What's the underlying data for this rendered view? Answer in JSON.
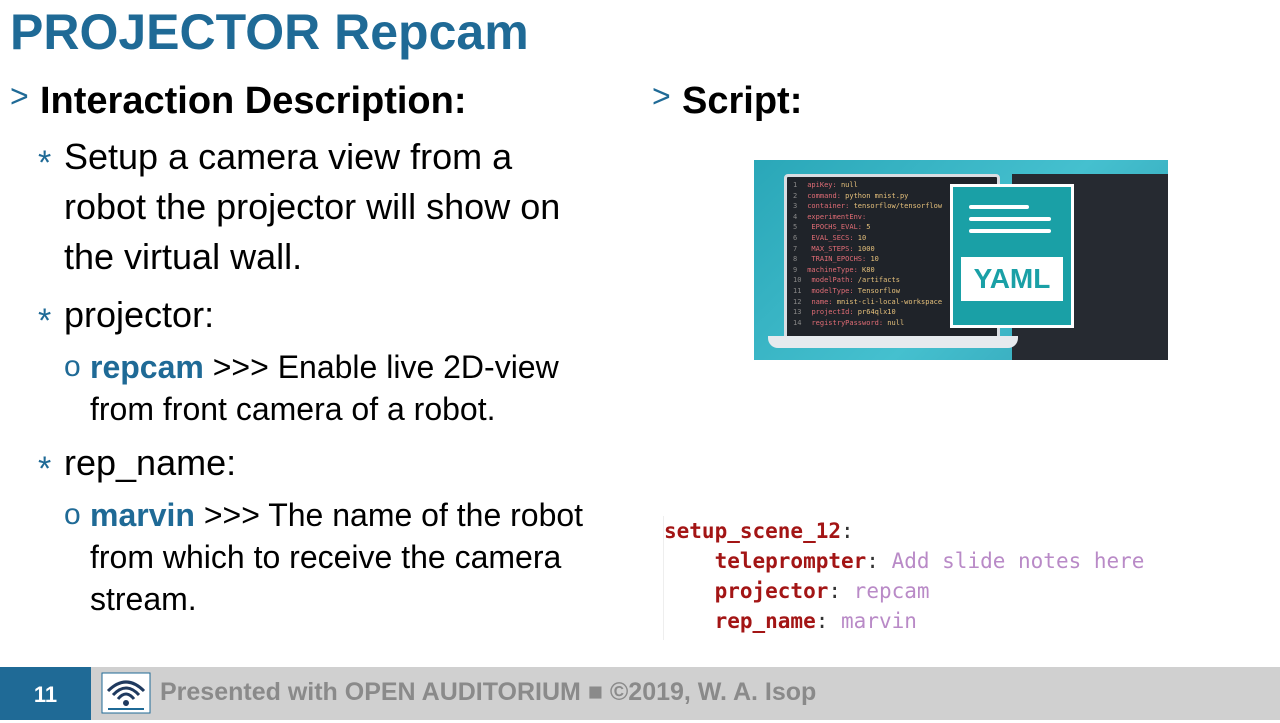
{
  "slide": {
    "title": "PROJECTOR Repcam"
  },
  "left": {
    "heading_marker": ">",
    "heading": "Interaction Description:",
    "bullets": [
      {
        "marker": "*",
        "text": "Setup a camera view from a robot the projector will show on the virtual wall."
      },
      {
        "marker": "*",
        "text": "projector:",
        "sub": {
          "marker": "o",
          "keyword": "repcam",
          "text": " >>> Enable live 2D-view from front camera of a robot."
        }
      },
      {
        "marker": "*",
        "text": "rep_name:",
        "sub": {
          "marker": "o",
          "keyword": "marvin",
          "text": " >>> The name of the robot from which to receive the camera stream."
        }
      }
    ]
  },
  "right": {
    "heading_marker": ">",
    "heading": "Script:",
    "image": {
      "badge": "YAML",
      "code_lines": [
        {
          "n": "1",
          "k": "apiKey:",
          "v": "null"
        },
        {
          "n": "2",
          "k": "command:",
          "v": "python mnist.py"
        },
        {
          "n": "3",
          "k": "container:",
          "v": "tensorflow/tensorflow"
        },
        {
          "n": "4",
          "k": "experimentEnv:",
          "v": ""
        },
        {
          "n": "5",
          "k": "  EPOCHS_EVAL:",
          "v": "5"
        },
        {
          "n": "6",
          "k": "  EVAL_SECS:",
          "v": "10"
        },
        {
          "n": "7",
          "k": "  MAX_STEPS:",
          "v": "1000"
        },
        {
          "n": "8",
          "k": "  TRAIN_EPOCHS:",
          "v": "10"
        },
        {
          "n": "9",
          "k": "machineType:",
          "v": "K80"
        },
        {
          "n": "10",
          "k": "modelPath:",
          "v": "/artifacts"
        },
        {
          "n": "11",
          "k": "modelType:",
          "v": "Tensorflow"
        },
        {
          "n": "12",
          "k": "name:",
          "v": "mnist-cli-local-workspace"
        },
        {
          "n": "13",
          "k": "projectId:",
          "v": "pr64qlx10"
        },
        {
          "n": "14",
          "k": "registryPassword:",
          "v": "null"
        }
      ]
    },
    "code": {
      "root_key": "setup_scene_12",
      "lines": [
        {
          "key": "teleprompter",
          "value": "Add slide notes here"
        },
        {
          "key": "projector",
          "value": "repcam"
        },
        {
          "key": "rep_name",
          "value": "marvin"
        }
      ]
    }
  },
  "footer": {
    "page_number": "11",
    "text": "Presented with OPEN AUDITORIUM ■ ©2019, W. A. Isop",
    "logo_icon": "wifi-logo-icon"
  },
  "colors": {
    "accent": "#1f6a96",
    "code_key": "#a31515",
    "code_value": "#b98ac7",
    "footer_bg": "#d0d0d0"
  }
}
